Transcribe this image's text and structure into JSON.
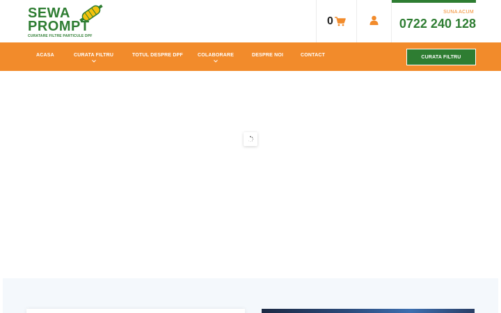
{
  "logo": {
    "line1": "SEWA",
    "line2": "PROMPT",
    "tagline": "CURATARE FILTRE PARTICULE DPF"
  },
  "header": {
    "cart_count": "0",
    "phone_label": "SUNA ACUM",
    "phone_number": "0722 240 128"
  },
  "nav": {
    "items": [
      {
        "label": "ACASA",
        "has_dropdown": false
      },
      {
        "label": "CURATA FILTRU",
        "has_dropdown": true
      },
      {
        "label": "TOTUL DESPRE DPF",
        "has_dropdown": false
      },
      {
        "label": "COLABORARE",
        "has_dropdown": true
      },
      {
        "label": "DESPRE NOI",
        "has_dropdown": false
      },
      {
        "label": "CONTACT",
        "has_dropdown": false
      }
    ],
    "cta_label": "CURATA FILTRU"
  },
  "colors": {
    "brand_green": "#2e7d32",
    "brand_orange": "#f28b2b"
  },
  "icons": {
    "cart": "shopping-cart-icon",
    "user": "user-icon",
    "dropdown": "chevron-down-icon",
    "loader": "spinner-icon"
  }
}
